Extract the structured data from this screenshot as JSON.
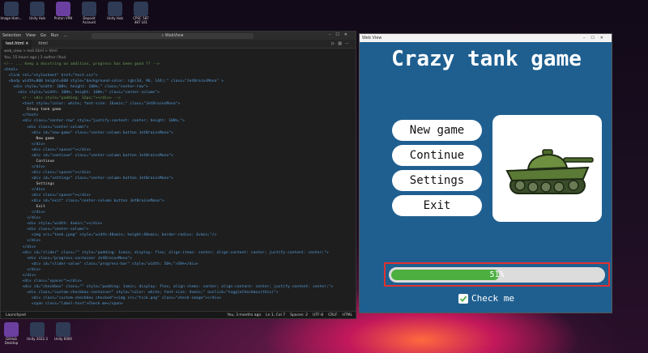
{
  "desktop": {
    "top_icons": [
      {
        "label": "Image Ham..."
      },
      {
        "label": "Unity Hub"
      },
      {
        "label": "Proton VPN"
      },
      {
        "label": "Deposit Account"
      },
      {
        "label": "Unity Hub"
      },
      {
        "label": "CPSC 587 487 L01"
      }
    ],
    "bottom_icons": [
      {
        "label": "GitHub Desktop"
      },
      {
        "label": "Unity 2022.3"
      },
      {
        "label": "Unity 6000"
      }
    ]
  },
  "vscode": {
    "menu": [
      "Selection",
      "View",
      "Go",
      "Run",
      "..."
    ],
    "search_placeholder": "WebView",
    "tabs": [
      "test.html",
      "html"
    ],
    "active_tab": "test.html",
    "breadcrumb": "web_view > test.html > html",
    "blame_line": "You, 15 hours ago | 1 author (You)",
    "code_lines": [
      {
        "cls": "c-cmt",
        "text": "<!-- ... keep a docstring on addition, progress has been good ?? -->"
      },
      {
        "cls": "c-tag",
        "text": "<html>"
      },
      {
        "cls": "c-tag",
        "text": "  <link rel=\"stylesheet\" href=\"test.css\">"
      },
      {
        "cls": "c-tag",
        "text": "  <body width=800 height=600 style=\"background-color: rgb(34, 96, 144);\" class=\"JetBrainsMono\" >"
      },
      {
        "cls": "c-tag",
        "text": "    <div style=\"width: 100%; height: 100%;\" class=\"center-row\">"
      },
      {
        "cls": "c-tag",
        "text": "      <div style=\"width: 100%; height: 100%;\" class=\"center-column\">"
      },
      {
        "cls": "c-cmt",
        "text": "        <!-- <div style=\"padding: 32px;\"></div> -->"
      },
      {
        "cls": "c-tag",
        "text": "        <text style=\"color: white; font-size: 16vmin;\" class=\"JetBrainsMono\">"
      },
      {
        "cls": "c-txt",
        "text": "          Crazy tank game"
      },
      {
        "cls": "c-tag",
        "text": "        </text>"
      },
      {
        "cls": "c-tag",
        "text": "        <div class=\"center-row\" style=\"justify-content: center; height: 100%;\">"
      },
      {
        "cls": "c-tag",
        "text": "          <div class=\"center-column\">"
      },
      {
        "cls": "c-tag",
        "text": "            <div id=\"new-game\" class=\"center-column button JetBrainsMono\">"
      },
      {
        "cls": "c-txt",
        "text": "              New game"
      },
      {
        "cls": "c-tag",
        "text": "            </div>"
      },
      {
        "cls": "c-tag",
        "text": "            <div class=\"spacer\"></div>"
      },
      {
        "cls": "c-tag",
        "text": "            <div id=\"continue\" class=\"center-column button JetBrainsMono\">"
      },
      {
        "cls": "c-txt",
        "text": "              Continue"
      },
      {
        "cls": "c-tag",
        "text": "            </div>"
      },
      {
        "cls": "c-tag",
        "text": "            <div class=\"spacer\"></div>"
      },
      {
        "cls": "c-tag",
        "text": "            <div id=\"settings\" class=\"center-column button JetBrainsMono\">"
      },
      {
        "cls": "c-txt",
        "text": "              Settings"
      },
      {
        "cls": "c-tag",
        "text": "            </div>"
      },
      {
        "cls": "c-tag",
        "text": "            <div class=\"spacer\"></div>"
      },
      {
        "cls": "c-tag",
        "text": "            <div id=\"exit\" class=\"center-column button JetBrainsMono\">"
      },
      {
        "cls": "c-txt",
        "text": "              Exit"
      },
      {
        "cls": "c-tag",
        "text": "            </div>"
      },
      {
        "cls": "c-tag",
        "text": "          </div>"
      },
      {
        "cls": "c-tag",
        "text": "          <div style=\"width: 4vmin;\"></div>"
      },
      {
        "cls": "c-tag",
        "text": "          <div class=\"center-column\">"
      },
      {
        "cls": "c-tag",
        "text": "            <img src=\"tank.jpeg\" style=\"width:40vmin; height:40vmin; border-radius: 4vmin;\"/>"
      },
      {
        "cls": "c-tag",
        "text": "          </div>"
      },
      {
        "cls": "c-tag",
        "text": "        </div>"
      },
      {
        "cls": "c-tag",
        "text": "        <div id=\"slider\" class=\"\" style=\"padding: 1vmin; display: flex; align-items: center; align-content: center; justify-content: center;\">"
      },
      {
        "cls": "c-tag",
        "text": "          <div class=\"progress-container JetBrainsMono\">"
      },
      {
        "cls": "c-tag",
        "text": "            <div id=\"slider-value\" class=\"progress-bar\" style=\"width: 50%;\">50%</div>"
      },
      {
        "cls": "c-tag",
        "text": "          </div>"
      },
      {
        "cls": "c-tag",
        "text": "        </div>"
      },
      {
        "cls": "c-tag",
        "text": "        <div class=\"spacer\"></div>"
      },
      {
        "cls": "c-tag",
        "text": "        <div id=\"checkbox\" class=\"\" style=\"padding: 1vmin; display: flex; align-items: center; align-content: center; justify-content: center;\">"
      },
      {
        "cls": "c-tag",
        "text": "          <div class=\"custom-checkbox-container\" style=\"color: white; font-size: 4vmin;\" onclick=\"toggleCheckbox(this)\">"
      },
      {
        "cls": "c-tag",
        "text": "            <div class=\"custom-checkbox checked\"><img src=\"tick.png\" class=\"check-image\"></div>"
      },
      {
        "cls": "c-tag",
        "text": "            <span class=\"label-text\">Check me</span>"
      }
    ],
    "status": {
      "left": "Launchpad",
      "blame": "You, 3 months ago",
      "cursor": "Ln 1, Col 7",
      "spaces": "Spaces: 2",
      "encoding": "UTF-8",
      "eol": "CRLF",
      "language": "HTML"
    }
  },
  "game_window": {
    "window_title": "Web View",
    "heading": "Crazy tank game",
    "menu_buttons": [
      "New game",
      "Continue",
      "Settings",
      "Exit"
    ],
    "progress": {
      "value": 0.51,
      "label": "51%"
    },
    "checkbox": {
      "checked": true,
      "label": "Check me"
    },
    "colors": {
      "background": "#1f5f90",
      "accent": "#4caf3f",
      "highlight": "#e0312f"
    },
    "image": "tank-icon"
  }
}
